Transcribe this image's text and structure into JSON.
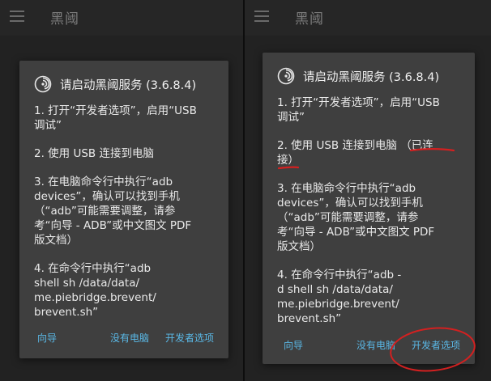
{
  "left": {
    "appbar": {
      "title": "黑阈"
    },
    "dialog": {
      "title": "请启动黑阈服务 (3.6.8.4)",
      "steps": [
        "1. 打开“开发者选项”，启用“USB\n调试”",
        "2. 使用 USB 连接到电脑",
        "3. 在电脑命令行中执行“adb\ndevices”，确认可以找到手机\n（“adb”可能需要调整，请参\n考“向导 - ADB”或中文图文 PDF\n版文档）",
        "4. 在命令行中执行“adb\nshell sh /data/data/\nme.piebridge.brevent/\nbrevent.sh”"
      ],
      "buttons": {
        "guide": "向导",
        "no_pc": "没有电脑",
        "dev_options": "开发者选项"
      }
    }
  },
  "right": {
    "appbar": {
      "title": "黑阈"
    },
    "dialog": {
      "title": "请启动黑阈服务 (3.6.8.4)",
      "steps": [
        "1. 打开“开发者选项”，启用“USB\n调试”",
        "2. 使用 USB 连接到电脑 （已连\n接）",
        "3. 在电脑命令行中执行“adb\ndevices”，确认可以找到手机\n（“adb”可能需要调整，请参\n考“向导 - ADB”或中文图文 PDF\n版文档）",
        "4. 在命令行中执行“adb -\nd shell sh /data/data/\nme.piebridge.brevent/\nbrevent.sh”"
      ],
      "buttons": {
        "guide": "向导",
        "no_pc": "没有电脑",
        "dev_options": "开发者选项"
      }
    }
  },
  "icons": {
    "menu": "hamburger-icon",
    "app": "brevent-swirl-icon"
  },
  "colors": {
    "dialog_bg": "#3f3f3f",
    "action_text": "#5ab8e6",
    "annotation": "#d32020"
  }
}
